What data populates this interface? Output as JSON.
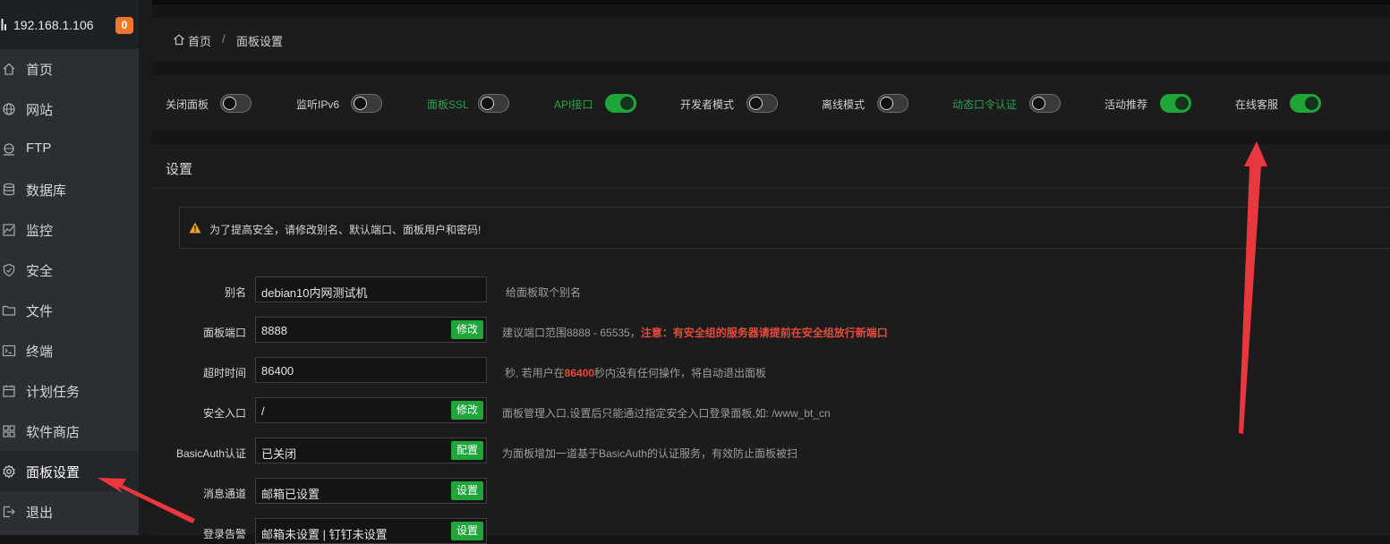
{
  "sidebar": {
    "ip": "192.168.1.106",
    "badge": "0",
    "items": [
      {
        "label": "首页"
      },
      {
        "label": "网站"
      },
      {
        "label": "FTP"
      },
      {
        "label": "数据库"
      },
      {
        "label": "监控"
      },
      {
        "label": "安全"
      },
      {
        "label": "文件"
      },
      {
        "label": "终端"
      },
      {
        "label": "计划任务"
      },
      {
        "label": "软件商店"
      },
      {
        "label": "面板设置"
      },
      {
        "label": "退出"
      }
    ]
  },
  "breadcrumb": {
    "home": "首页",
    "sep": "/",
    "current": "面板设置"
  },
  "switches": [
    {
      "label": "关闭面板",
      "on": false
    },
    {
      "label": "监听IPv6",
      "on": false
    },
    {
      "label": "面板SSL",
      "on": false
    },
    {
      "label": "API接口",
      "on": true
    },
    {
      "label": "开发者模式",
      "on": false
    },
    {
      "label": "离线模式",
      "on": false
    },
    {
      "label": "动态口令认证",
      "on": false
    },
    {
      "label": "活动推荐",
      "on": true
    },
    {
      "label": "在线客服",
      "on": true
    }
  ],
  "settings": {
    "title": "设置",
    "alert": "为了提高安全，请修改别名、默认端口、面板用户和密码!",
    "rows": [
      {
        "label": "别名",
        "value": "debian10内网测试机",
        "button": "",
        "hint": "给面板取个别名"
      },
      {
        "label": "面板端口",
        "value": "8888",
        "button": "修改",
        "hint": "建议端口范围8888 - 65535，",
        "hint_red": "注意：有安全组的服务器请提前在安全组放行新端口"
      },
      {
        "label": "超时时间",
        "value": "86400",
        "button": "",
        "hint_pre": "秒, 若用户在",
        "hint_red": "86400",
        "hint_post": "秒内没有任何操作，将自动退出面板"
      },
      {
        "label": "安全入口",
        "value": "/",
        "button": "修改",
        "hint": "面板管理入口,设置后只能通过指定安全入口登录面板,如: /www_bt_cn"
      },
      {
        "label": "BasicAuth认证",
        "value": "已关闭",
        "button": "配置",
        "hint": "为面板增加一道基于BasicAuth的认证服务，有效防止面板被扫"
      },
      {
        "label": "消息通道",
        "value": "邮箱已设置",
        "button": "设置",
        "hint": ""
      },
      {
        "label": "登录告警",
        "value": "邮箱未设置 | 钉钉未设置",
        "button": "设置",
        "hint": ""
      }
    ]
  },
  "colors": {
    "accent": "#20a53a",
    "warning": "#f0a020",
    "annotation": "#e8383d",
    "badge": "#f0762a"
  }
}
